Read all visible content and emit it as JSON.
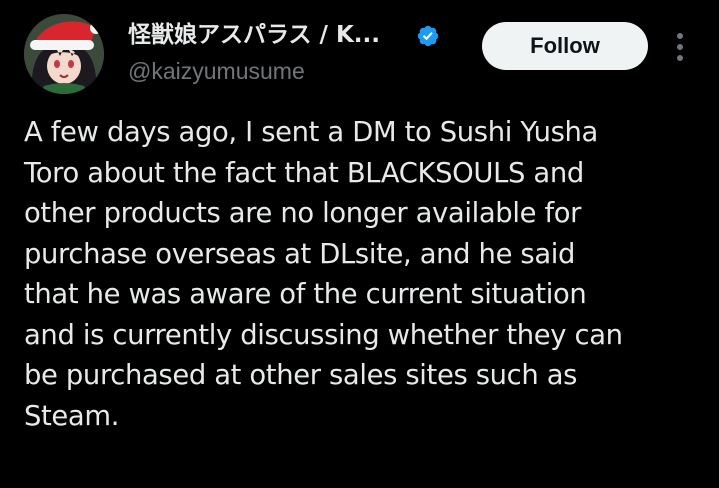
{
  "tweet": {
    "author": {
      "display_name": "怪獣娘アスパラス / K...",
      "handle": "@kaizyumusume",
      "avatar_icon": "avatar-santa-hat-girl",
      "verified": true,
      "verified_icon": "verified-badge-icon"
    },
    "follow_label": "Follow",
    "more_icon": "more-vertical-icon",
    "text_lines": [
      "A few days ago, I sent a DM to Sushi Yusha",
      "Toro about the fact that BLACKSOULS and",
      "other products are no longer available for",
      "purchase overseas at DLsite, and he said",
      "that he was aware of the current situation",
      "and is currently discussing whether they can",
      "be purchased at other sales sites such as",
      "Steam."
    ]
  },
  "colors": {
    "background": "#000000",
    "text_primary": "#e7e9ea",
    "text_secondary": "#71767b",
    "verified": "#1d9bf0",
    "follow_bg": "#eff3f4",
    "follow_text": "#0f1419"
  }
}
